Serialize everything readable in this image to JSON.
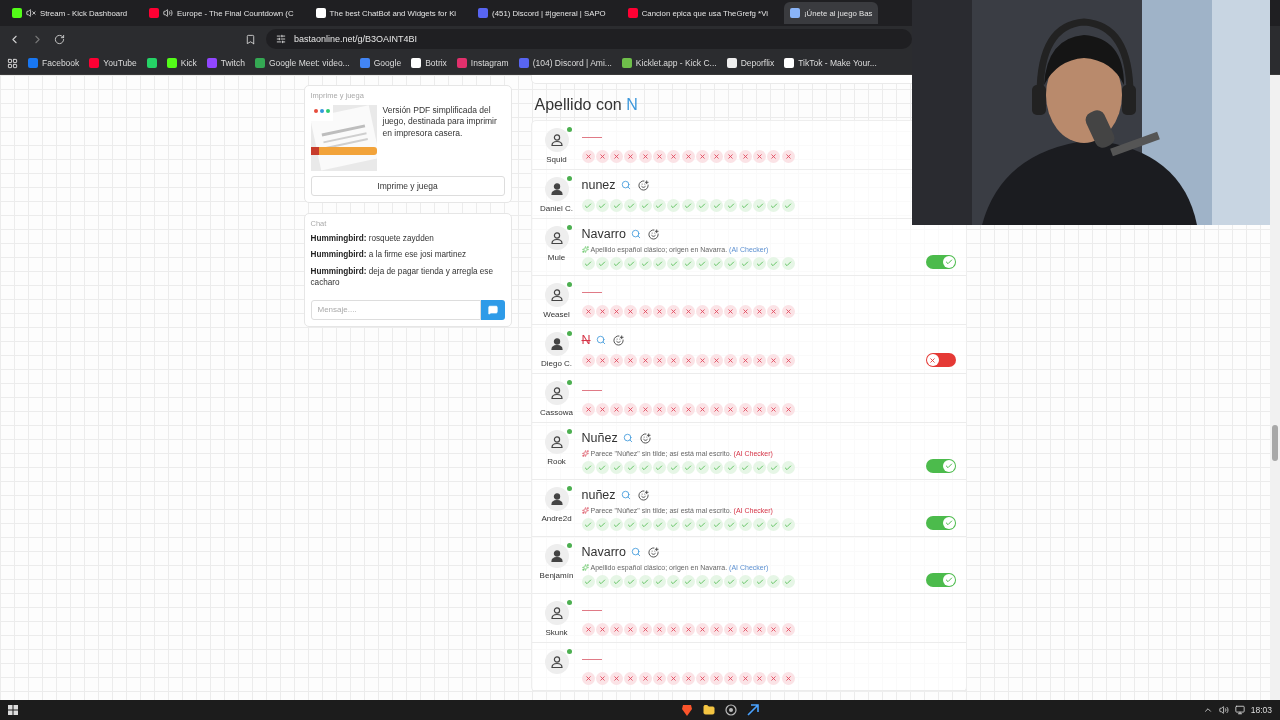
{
  "tabs": [
    {
      "title": "Stream - Kick Dashboard",
      "audio": {
        "muted": true
      },
      "selected": false
    },
    {
      "title": "Europe - The Final Countdown (C",
      "audio": {
        "muted": false
      },
      "selected": false
    },
    {
      "title": "The best ChatBot and Widgets for Ki",
      "selected": false
    },
    {
      "title": "(451) Discord | #|general | SAPO",
      "selected": false
    },
    {
      "title": "Cancion epica que usa TheGrefg *Vi",
      "selected": false
    },
    {
      "title": "¡Únete al juego Bas",
      "selected": true
    }
  ],
  "address": "bastaonline.net/g/B3OAINT4BI",
  "bookmarks": [
    {
      "kind": "labelled",
      "label": "Facebook"
    },
    {
      "kind": "labelled",
      "label": "YouTube"
    },
    {
      "kind": "icon-only"
    },
    {
      "kind": "labelled",
      "label": "Kick"
    },
    {
      "kind": "labelled",
      "label": "Twitch"
    },
    {
      "kind": "labelled",
      "label": "Google Meet: video..."
    },
    {
      "kind": "labelled",
      "label": "Google"
    },
    {
      "kind": "labelled",
      "label": "Botrix"
    },
    {
      "kind": "labelled",
      "label": "Instagram"
    },
    {
      "kind": "labelled",
      "label": "(104) Discord | Ami..."
    },
    {
      "kind": "labelled",
      "label": "Kicklet.app - Kick C..."
    },
    {
      "kind": "labelled",
      "label": "Deporflix"
    },
    {
      "kind": "labelled",
      "label": "TikTok - Make Your..."
    }
  ],
  "print_card": {
    "title": "Imprime y juega",
    "text": "Versión PDF simplificada del juego, destinada para imprimir en impresora casera.",
    "button": "Imprime y juega"
  },
  "chat": {
    "title": "Chat",
    "messages": [
      {
        "author": "Hummingbird:",
        "text": "rosquete zaydden"
      },
      {
        "author": "Hummingbird:",
        "text": "a la firme ese josi martinez"
      },
      {
        "author": "Hummingbird:",
        "text": "deja de pagar tienda y arregla ese cacharo"
      }
    ],
    "placeholder": "Mensaje...."
  },
  "category": {
    "label": "Apellido con",
    "letter": "N"
  },
  "rows": [
    {
      "user": "Squid",
      "avatar_filled": false,
      "marks": [
        false,
        false,
        false,
        false,
        false,
        false,
        false,
        false,
        false,
        false,
        false,
        false,
        false,
        false,
        false
      ]
    },
    {
      "user": "Daniel C.",
      "avatar_filled": true,
      "answer": "nunez",
      "rejected": false,
      "marks": [
        true,
        true,
        true,
        true,
        true,
        true,
        true,
        true,
        true,
        true,
        true,
        true,
        true,
        true,
        true
      ]
    },
    {
      "user": "Mule",
      "avatar_filled": false,
      "answer": "Navarro",
      "rejected": false,
      "note": {
        "warning": false,
        "text": "Apellido español clásico; origen en Navarra.",
        "source": "(AI Checker)"
      },
      "marks": [
        true,
        true,
        true,
        true,
        true,
        true,
        true,
        true,
        true,
        true,
        true,
        true,
        true,
        true,
        true
      ],
      "toggle": {
        "on": true
      }
    },
    {
      "user": "Weasel",
      "avatar_filled": false,
      "marks": [
        false,
        false,
        false,
        false,
        false,
        false,
        false,
        false,
        false,
        false,
        false,
        false,
        false,
        false,
        false
      ]
    },
    {
      "user": "Diego C.",
      "avatar_filled": true,
      "answer": "N",
      "rejected": true,
      "marks": [
        false,
        false,
        false,
        false,
        false,
        false,
        false,
        false,
        false,
        false,
        false,
        false,
        false,
        false,
        false
      ],
      "toggle": {
        "on": false
      }
    },
    {
      "user": "Cassowa",
      "avatar_filled": false,
      "marks": [
        false,
        false,
        false,
        false,
        false,
        false,
        false,
        false,
        false,
        false,
        false,
        false,
        false,
        false,
        false
      ]
    },
    {
      "user": "Rook",
      "avatar_filled": false,
      "answer": "Nuñez",
      "rejected": false,
      "note": {
        "warning": true,
        "text": "Parece \"Núñez\" sin tilde; así está mal escrito.",
        "source": "(AI Checker)"
      },
      "marks": [
        true,
        true,
        true,
        true,
        true,
        true,
        true,
        true,
        true,
        true,
        true,
        true,
        true,
        true,
        true
      ],
      "toggle": {
        "on": true
      }
    },
    {
      "user": "Andre2d",
      "avatar_filled": true,
      "answer": "nuñez",
      "rejected": false,
      "note": {
        "warning": true,
        "text": "Parece \"Núñez\" sin tilde; así está mal escrito.",
        "source": "(AI Checker)"
      },
      "marks": [
        true,
        true,
        true,
        true,
        true,
        true,
        true,
        true,
        true,
        true,
        true,
        true,
        true,
        true,
        true
      ],
      "toggle": {
        "on": true
      }
    },
    {
      "user": "Benjamín",
      "avatar_filled": true,
      "answer": "Navarro",
      "rejected": false,
      "note": {
        "warning": false,
        "text": "Apellido español clásico; origen en Navarra.",
        "source": "(AI Checker)"
      },
      "marks": [
        true,
        true,
        true,
        true,
        true,
        true,
        true,
        true,
        true,
        true,
        true,
        true,
        true,
        true,
        true
      ],
      "toggle": {
        "on": true
      }
    },
    {
      "user": "Skunk",
      "avatar_filled": false,
      "marks": [
        false,
        false,
        false,
        false,
        false,
        false,
        false,
        false,
        false,
        false,
        false,
        false,
        false,
        false,
        false
      ]
    },
    {
      "avatar_filled": false,
      "marks": [
        false,
        false,
        false,
        false,
        false,
        false,
        false,
        false,
        false,
        false,
        false,
        false,
        false,
        false,
        false
      ]
    }
  ],
  "taskbar": {
    "time": "18:03"
  }
}
